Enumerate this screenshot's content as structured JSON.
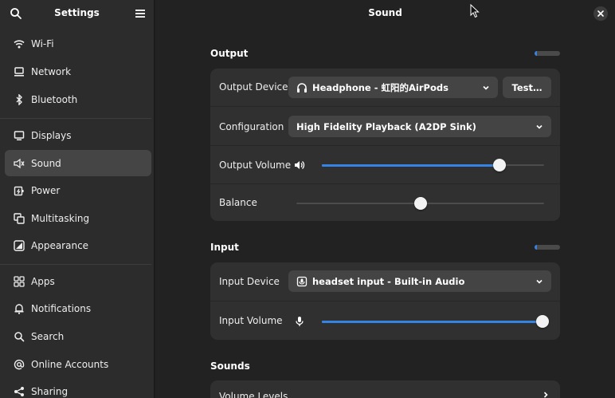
{
  "sidebar": {
    "title": "Settings",
    "items": [
      {
        "label": "Wi-Fi",
        "icon": "wifi-icon"
      },
      {
        "label": "Network",
        "icon": "network-icon"
      },
      {
        "label": "Bluetooth",
        "icon": "bluetooth-icon"
      },
      {
        "label": "Displays",
        "icon": "display-icon"
      },
      {
        "label": "Sound",
        "icon": "speaker-icon",
        "selected": true
      },
      {
        "label": "Power",
        "icon": "power-icon"
      },
      {
        "label": "Multitasking",
        "icon": "multitasking-icon"
      },
      {
        "label": "Appearance",
        "icon": "appearance-icon"
      },
      {
        "label": "Apps",
        "icon": "apps-grid-icon"
      },
      {
        "label": "Notifications",
        "icon": "bell-icon"
      },
      {
        "label": "Search",
        "icon": "search-icon"
      },
      {
        "label": "Online Accounts",
        "icon": "at-icon"
      },
      {
        "label": "Sharing",
        "icon": "share-icon"
      }
    ]
  },
  "page": {
    "title": "Sound"
  },
  "output": {
    "section_title": "Output",
    "level": 0.1,
    "device_label": "Output Device",
    "device_value": "Headphone - 虹阳的AirPods",
    "test_label": "Test…",
    "config_label": "Configuration",
    "config_value": "High Fidelity Playback (A2DP Sink)",
    "volume_label": "Output Volume",
    "volume": 0.8,
    "balance_label": "Balance",
    "balance": 0.5
  },
  "input": {
    "section_title": "Input",
    "level": 0.1,
    "device_label": "Input Device",
    "device_value": "headset input - Built-in Audio",
    "volume_label": "Input Volume",
    "volume": 1.0
  },
  "sounds": {
    "section_title": "Sounds",
    "volume_levels_label": "Volume Levels"
  },
  "colors": {
    "accent": "#3584e4",
    "sidebar_bg": "#2c2c2c",
    "main_bg": "#222222",
    "card_bg": "#303030"
  }
}
